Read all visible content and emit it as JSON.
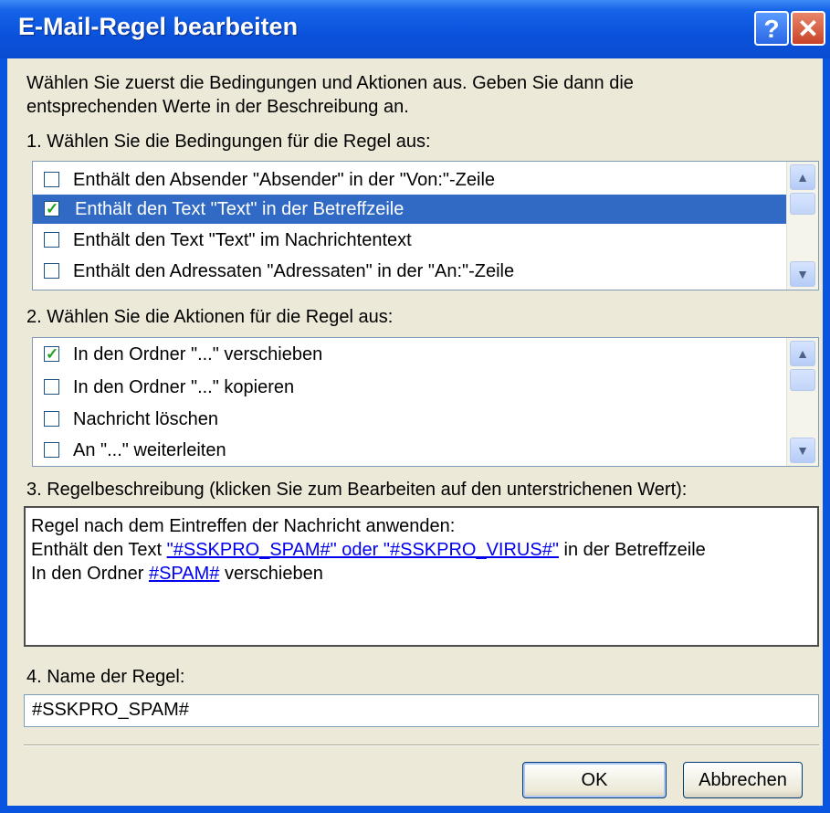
{
  "dialog": {
    "title": "E-Mail-Regel bearbeiten",
    "help_label": "?",
    "close_label": "✕",
    "intro_line1": "Wählen Sie zuerst die Bedingungen und Aktionen aus. Geben Sie dann die",
    "intro_line2": "entsprechenden Werte in der Beschreibung an."
  },
  "conditions": {
    "label": "1. Wählen Sie die Bedingungen für die Regel aus:",
    "items": [
      {
        "label": "Enthält den Absender \"Absender\" in der \"Von:\"-Zeile",
        "checked": false,
        "selected": false
      },
      {
        "label": "Enthält den Text \"Text\" in der Betreffzeile",
        "checked": true,
        "selected": true
      },
      {
        "label": "Enthält den Text \"Text\" im Nachrichtentext",
        "checked": false,
        "selected": false
      },
      {
        "label": "Enthält den Adressaten \"Adressaten\" in der \"An:\"-Zeile",
        "checked": false,
        "selected": false
      }
    ]
  },
  "actions": {
    "label": "2. Wählen Sie die Aktionen für die Regel aus:",
    "items": [
      {
        "label": "In den Ordner \"...\" verschieben",
        "checked": true,
        "selected": false
      },
      {
        "label": "In den Ordner \"...\" kopieren",
        "checked": false,
        "selected": false
      },
      {
        "label": "Nachricht löschen",
        "checked": false,
        "selected": false
      },
      {
        "label": "An \"...\" weiterleiten",
        "checked": false,
        "selected": false
      }
    ]
  },
  "description": {
    "label": "3. Regelbeschreibung (klicken Sie zum Bearbeiten auf den unterstrichenen Wert):",
    "line1": "Regel nach dem Eintreffen der Nachricht anwenden:",
    "line2_prefix": "Enthält den Text ",
    "line2_link": "\"#SSKPRO_SPAM#\" oder \"#SSKPRO_VIRUS#\"",
    "line2_suffix": " in der Betreffzeile",
    "line3_prefix": "In den Ordner ",
    "line3_link": "#SPAM#",
    "line3_suffix": " verschieben"
  },
  "rule_name": {
    "label": "4. Name der Regel:",
    "value": "#SSKPRO_SPAM#"
  },
  "buttons": {
    "ok": "OK",
    "cancel": "Abbrechen"
  },
  "icons": {
    "scroll_up": "chevron-up-icon",
    "scroll_down": "chevron-down-icon",
    "checkbox_check": "checkmark-icon"
  },
  "colors": {
    "title_bar": "#0a52dc",
    "selection": "#316ac5",
    "link": "#0000ee",
    "dialog_bg": "#ece9d8"
  }
}
